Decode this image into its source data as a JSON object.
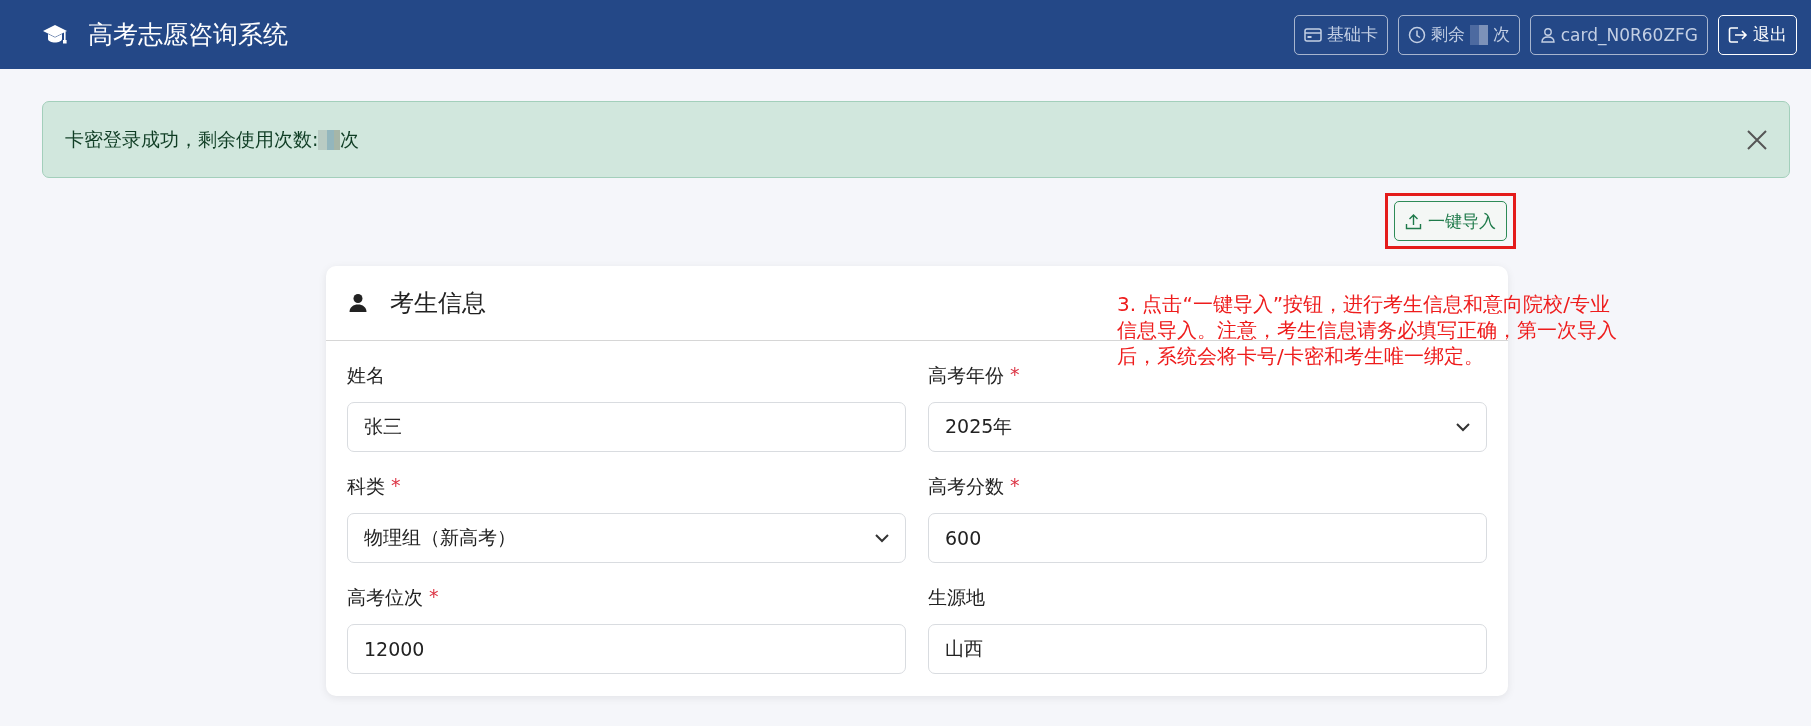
{
  "header": {
    "title": "高考志愿咨询系统",
    "badges": [
      {
        "kind": "card",
        "label": "基础卡"
      },
      {
        "kind": "remaining",
        "label": "剩余",
        "suffix": "次"
      },
      {
        "kind": "user",
        "label": "card_N0R60ZFG"
      }
    ],
    "logout": "退出"
  },
  "alert": {
    "text": "卡密登录成功，剩余使用次数: ",
    "suffix": "次"
  },
  "import_button": "一键导入",
  "annotation": "3. 点击“一键导入”按钮，进行考生信息和意向院校/专业信息导入。注意，考生信息请务必填写正确，第一次导入后，系统会将卡号/卡密和考生唯一绑定。",
  "card": {
    "title": "考生信息",
    "fields": [
      {
        "kind": "input",
        "label": "姓名",
        "value": "张三"
      },
      {
        "kind": "select",
        "label": "高考年份",
        "required_mark": "*",
        "value": "2025年"
      },
      {
        "kind": "select",
        "label": "科类",
        "required_mark": "*",
        "value": "物理组（新高考）"
      },
      {
        "kind": "input",
        "label": "高考分数",
        "required_mark": "*",
        "value": "600"
      },
      {
        "kind": "input",
        "label": "高考位次",
        "required_mark": "*",
        "value": "12000"
      },
      {
        "kind": "input",
        "label": "生源地",
        "value": "山西"
      }
    ]
  }
}
